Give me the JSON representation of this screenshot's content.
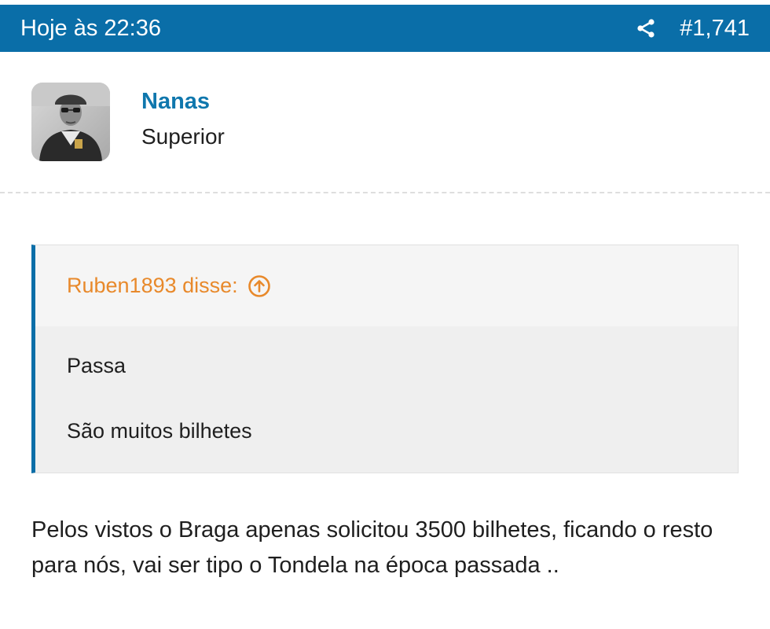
{
  "header": {
    "timestamp": "Hoje às 22:36",
    "post_number": "#1,741",
    "share_icon": "share-icon",
    "background_color": "#0a6ea8"
  },
  "author": {
    "name": "Nanas",
    "title": "Superior",
    "name_color": "#0f77ad"
  },
  "quote": {
    "author_label": "Ruben1893 disse:",
    "arrow_icon": "arrow-up-circle-icon",
    "accent_color": "#e8892b",
    "lines": [
      "Passa",
      "São muitos bilhetes"
    ]
  },
  "message": {
    "text": "Pelos vistos o Braga apenas solicitou 3500 bilhetes, ficando o resto para nós, vai ser tipo o Tondela na época passada .."
  }
}
